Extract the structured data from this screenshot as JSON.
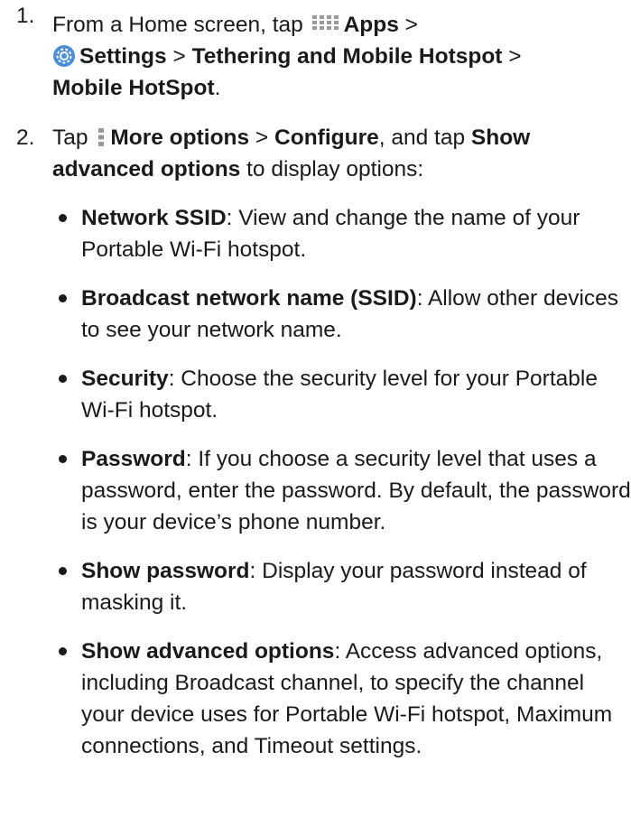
{
  "step1": {
    "number": "1.",
    "t1": "From a Home screen, tap",
    "apps": "Apps",
    "sep1": " >",
    "settings": "Settings",
    "sep2": " > ",
    "tethering": "Tethering and Mobile Hotspot",
    "sep3": " > ",
    "hotspot": "Mobile HotSpot",
    "end": "."
  },
  "step2": {
    "number": "2.",
    "t1": "Tap",
    "more": "More options",
    "sep1": " > ",
    "configure": "Configure",
    "t2": ", and tap ",
    "show_adv": "Show advanced options",
    "t3": " to display options:"
  },
  "options": [
    {
      "term": "Network SSID",
      "desc": ": View and change the name of your Portable Wi-Fi hotspot."
    },
    {
      "term": "Broadcast network name (SSID)",
      "desc": ": Allow other devices to see your network name."
    },
    {
      "term": "Security",
      "desc": ": Choose the security level for your Portable Wi-Fi hotspot."
    },
    {
      "term": "Password",
      "desc": ": If you choose a security level that uses a password, enter the password. By default, the password is your device’s phone number."
    },
    {
      "term": "Show password",
      "desc": ": Display your password instead of masking it."
    },
    {
      "term": "Show advanced options",
      "desc": ": Access advanced options, including Broadcast channel, to specify the channel your device uses for Portable Wi-Fi hotspot, Maximum connections, and Timeout settings."
    }
  ],
  "icons": {
    "apps": "apps-grid-icon",
    "settings": "gear-icon",
    "more": "more-options-icon",
    "gear_color": "#2b6fb6"
  }
}
